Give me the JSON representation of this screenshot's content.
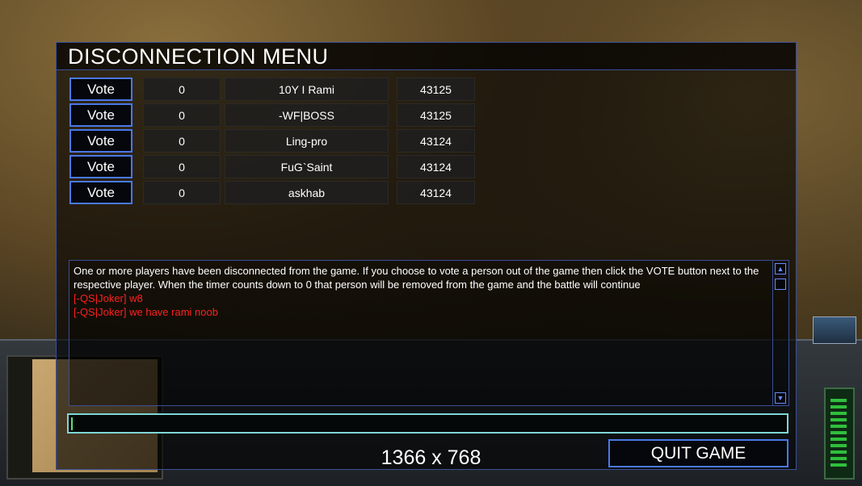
{
  "dialog": {
    "title": "DISCONNECTION MENU",
    "players": [
      {
        "vote_label": "Vote",
        "timer": "0",
        "name": "10Y I Rami",
        "ping": "43125"
      },
      {
        "vote_label": "Vote",
        "timer": "0",
        "name": "-WF|BOSS",
        "ping": "43125"
      },
      {
        "vote_label": "Vote",
        "timer": "0",
        "name": "Ling-pro",
        "ping": "43124"
      },
      {
        "vote_label": "Vote",
        "timer": "0",
        "name": "FuG`Saint",
        "ping": "43124"
      },
      {
        "vote_label": "Vote",
        "timer": "0",
        "name": "askhab",
        "ping": "43124"
      }
    ],
    "chat": {
      "info": "One or more players have been disconnected from the game. If you choose to vote a person out of the game then click the VOTE button next to the respective player. When the timer counts down to 0 that person will be removed from the game and the battle will continue",
      "messages": [
        "[-QS|Joker] w8",
        "[-QS|Joker] we have rami noob"
      ]
    },
    "chat_input_value": "",
    "resolution_label": "1366 x 768",
    "quit_label": "QUIT GAME"
  },
  "colors": {
    "button_border": "#4a78e8",
    "chat_message": "#ff2020",
    "input_border": "#7fd6d6"
  },
  "icons": {
    "scroll_up": "triangle-up-icon",
    "scroll_down": "triangle-down-icon"
  }
}
